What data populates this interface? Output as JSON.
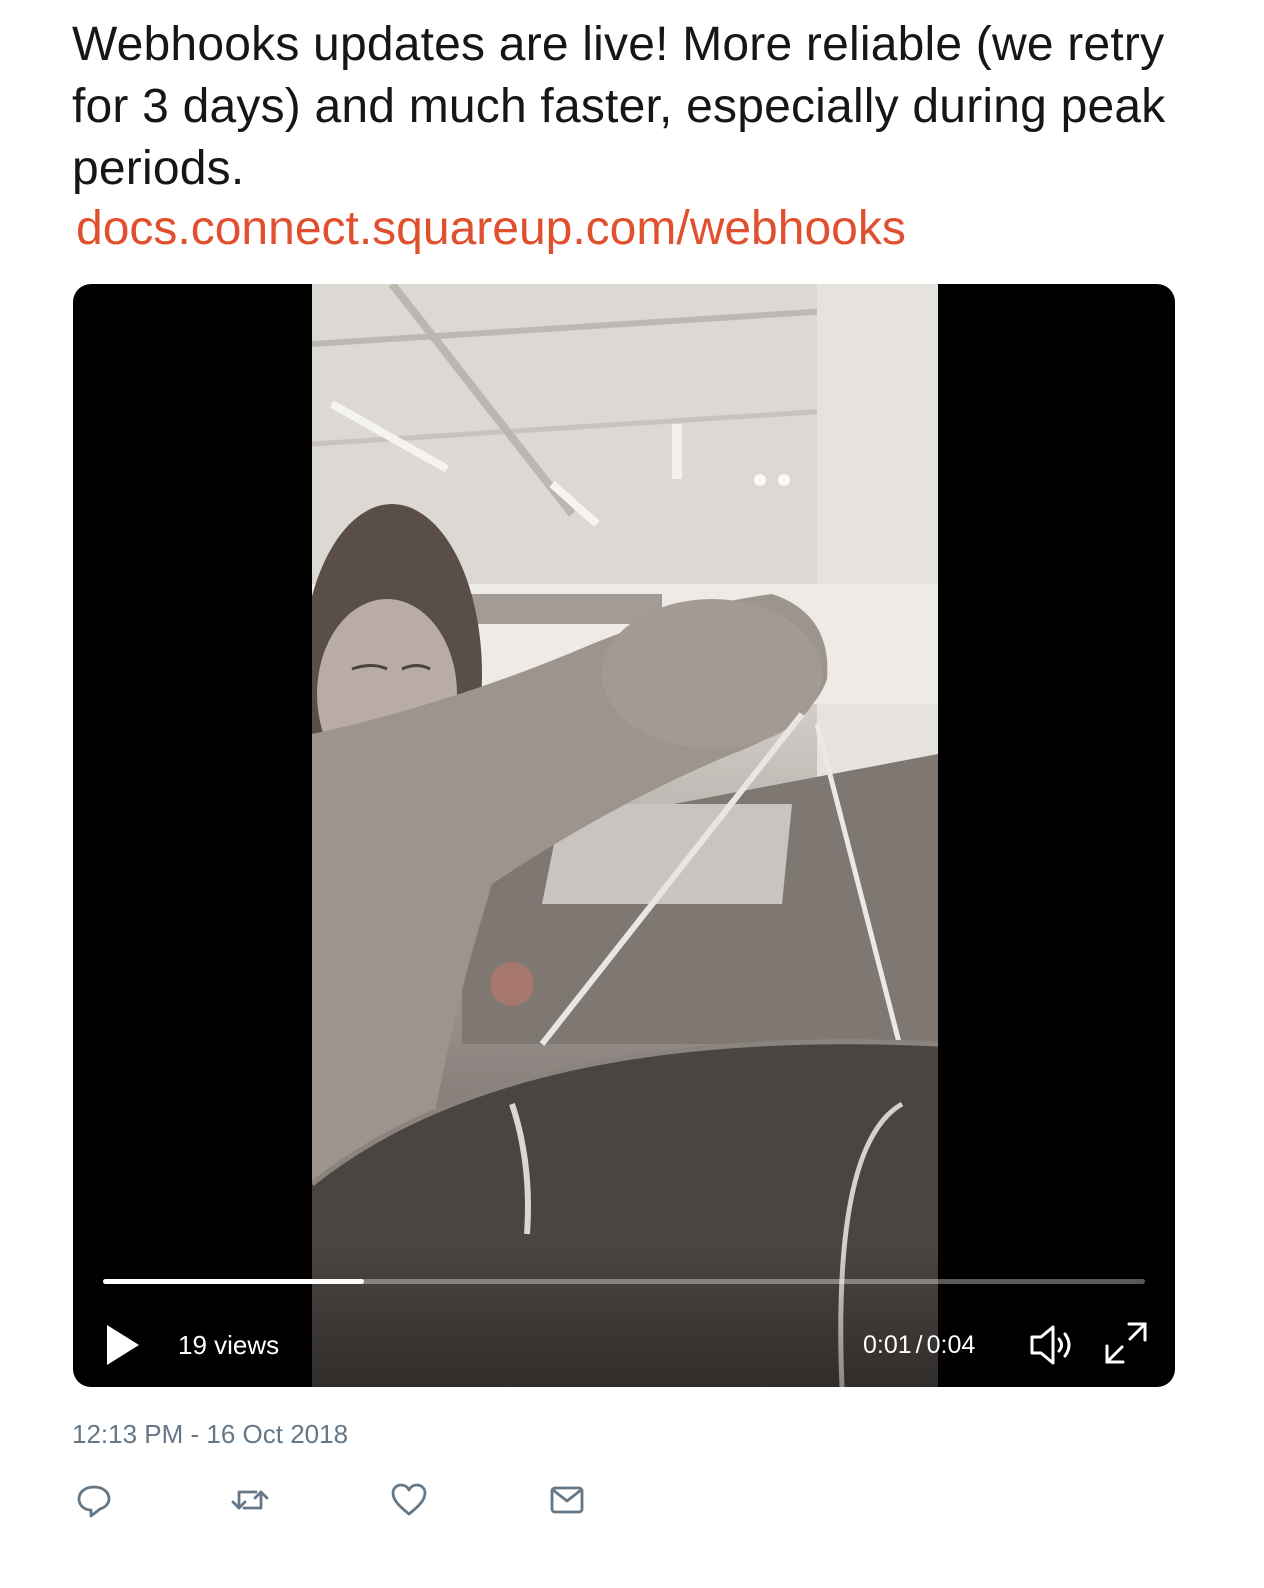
{
  "tweet": {
    "text": "Webhooks updates are live! More reliable (we retry for 3 days) and much faster, especially during peak periods.",
    "link": "docs.connect.squareup.com/webhooks",
    "timestamp": "12:13 PM - 16 Oct 2018"
  },
  "video": {
    "views": "19 views",
    "current_time": "0:01",
    "separator": "/",
    "duration": "0:04",
    "progress": 0.25,
    "play_icon": "play-icon",
    "volume_icon": "volume-icon",
    "fullscreen_icon": "fullscreen-icon"
  },
  "actions": [
    {
      "icon": "reply-icon"
    },
    {
      "icon": "retweet-icon"
    },
    {
      "icon": "like-icon"
    },
    {
      "icon": "message-icon"
    }
  ],
  "colors": {
    "text": "#14171a",
    "link": "#e0502e",
    "muted": "#657786",
    "video_bg": "#000000"
  }
}
